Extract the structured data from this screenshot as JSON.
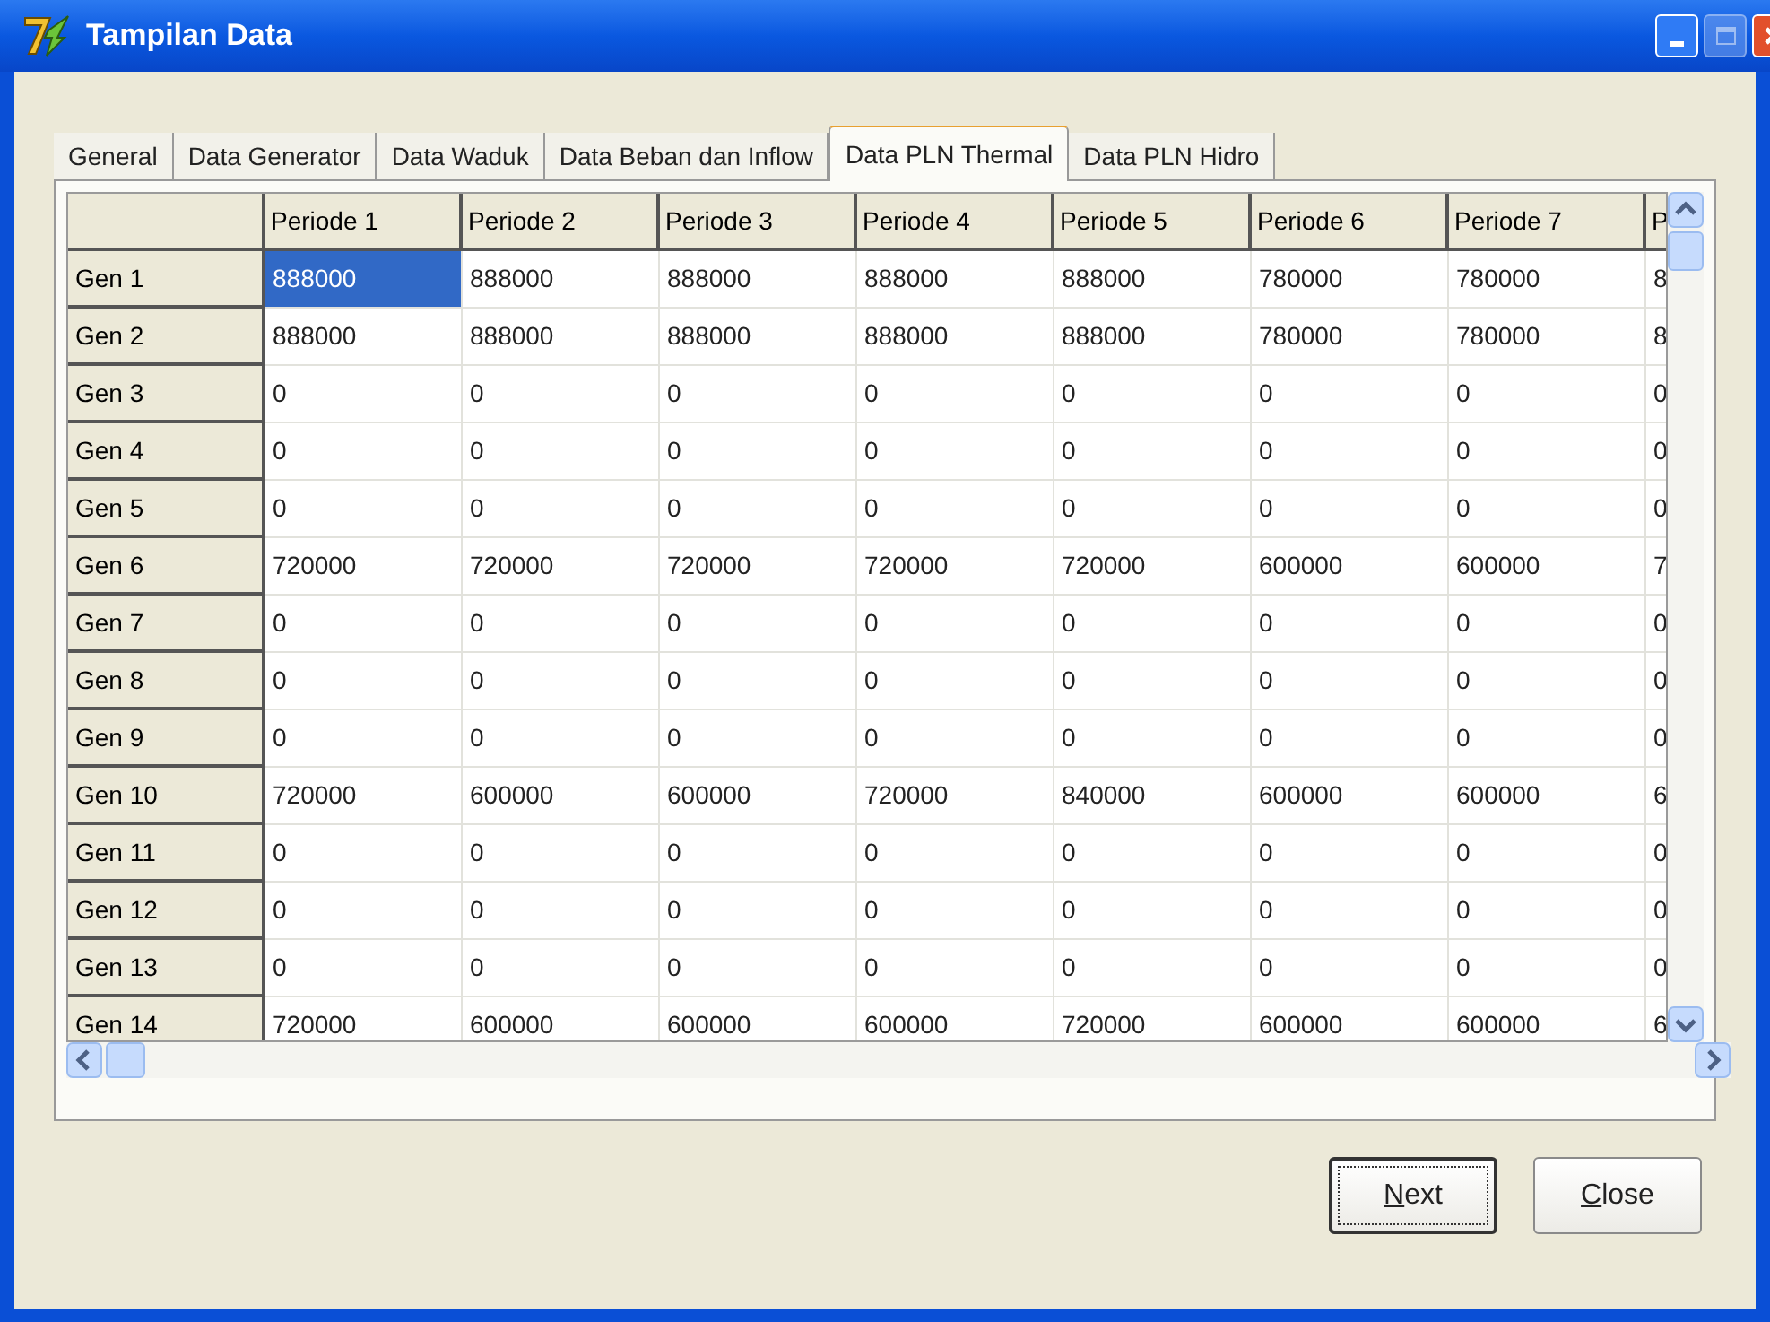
{
  "window": {
    "title": "Tampilan Data",
    "maximize_disabled": true
  },
  "tabs": [
    {
      "label": "General",
      "selected": false
    },
    {
      "label": "Data Generator",
      "selected": false
    },
    {
      "label": "Data Waduk",
      "selected": false
    },
    {
      "label": "Data Beban dan Inflow",
      "selected": false
    },
    {
      "label": "Data PLN Thermal",
      "selected": true
    },
    {
      "label": "Data PLN Hidro",
      "selected": false
    }
  ],
  "table": {
    "columns": [
      "Periode 1",
      "Periode 2",
      "Periode 3",
      "Periode 4",
      "Periode 5",
      "Periode 6",
      "Periode 7",
      "P"
    ],
    "rows": [
      {
        "header": "Gen 1",
        "cells": [
          {
            "text": "888000",
            "selected": true
          },
          {
            "text": "888000",
            "selected": false
          },
          {
            "text": "888000",
            "selected": false
          },
          {
            "text": "888000",
            "selected": false
          },
          {
            "text": "888000",
            "selected": false
          },
          {
            "text": "780000",
            "selected": false
          },
          {
            "text": "780000",
            "selected": false
          },
          {
            "text": "8",
            "selected": false
          }
        ]
      },
      {
        "header": "Gen 2",
        "cells": [
          {
            "text": "888000",
            "selected": false
          },
          {
            "text": "888000",
            "selected": false
          },
          {
            "text": "888000",
            "selected": false
          },
          {
            "text": "888000",
            "selected": false
          },
          {
            "text": "888000",
            "selected": false
          },
          {
            "text": "780000",
            "selected": false
          },
          {
            "text": "780000",
            "selected": false
          },
          {
            "text": "8",
            "selected": false
          }
        ]
      },
      {
        "header": "Gen 3",
        "cells": [
          {
            "text": "0",
            "selected": false
          },
          {
            "text": "0",
            "selected": false
          },
          {
            "text": "0",
            "selected": false
          },
          {
            "text": "0",
            "selected": false
          },
          {
            "text": "0",
            "selected": false
          },
          {
            "text": "0",
            "selected": false
          },
          {
            "text": "0",
            "selected": false
          },
          {
            "text": "0",
            "selected": false
          }
        ]
      },
      {
        "header": "Gen 4",
        "cells": [
          {
            "text": "0",
            "selected": false
          },
          {
            "text": "0",
            "selected": false
          },
          {
            "text": "0",
            "selected": false
          },
          {
            "text": "0",
            "selected": false
          },
          {
            "text": "0",
            "selected": false
          },
          {
            "text": "0",
            "selected": false
          },
          {
            "text": "0",
            "selected": false
          },
          {
            "text": "0",
            "selected": false
          }
        ]
      },
      {
        "header": "Gen 5",
        "cells": [
          {
            "text": "0",
            "selected": false
          },
          {
            "text": "0",
            "selected": false
          },
          {
            "text": "0",
            "selected": false
          },
          {
            "text": "0",
            "selected": false
          },
          {
            "text": "0",
            "selected": false
          },
          {
            "text": "0",
            "selected": false
          },
          {
            "text": "0",
            "selected": false
          },
          {
            "text": "0",
            "selected": false
          }
        ]
      },
      {
        "header": "Gen 6",
        "cells": [
          {
            "text": "720000",
            "selected": false
          },
          {
            "text": "720000",
            "selected": false
          },
          {
            "text": "720000",
            "selected": false
          },
          {
            "text": "720000",
            "selected": false
          },
          {
            "text": "720000",
            "selected": false
          },
          {
            "text": "600000",
            "selected": false
          },
          {
            "text": "600000",
            "selected": false
          },
          {
            "text": "7",
            "selected": false
          }
        ]
      },
      {
        "header": "Gen 7",
        "cells": [
          {
            "text": "0",
            "selected": false
          },
          {
            "text": "0",
            "selected": false
          },
          {
            "text": "0",
            "selected": false
          },
          {
            "text": "0",
            "selected": false
          },
          {
            "text": "0",
            "selected": false
          },
          {
            "text": "0",
            "selected": false
          },
          {
            "text": "0",
            "selected": false
          },
          {
            "text": "0",
            "selected": false
          }
        ]
      },
      {
        "header": "Gen 8",
        "cells": [
          {
            "text": "0",
            "selected": false
          },
          {
            "text": "0",
            "selected": false
          },
          {
            "text": "0",
            "selected": false
          },
          {
            "text": "0",
            "selected": false
          },
          {
            "text": "0",
            "selected": false
          },
          {
            "text": "0",
            "selected": false
          },
          {
            "text": "0",
            "selected": false
          },
          {
            "text": "0",
            "selected": false
          }
        ]
      },
      {
        "header": "Gen 9",
        "cells": [
          {
            "text": "0",
            "selected": false
          },
          {
            "text": "0",
            "selected": false
          },
          {
            "text": "0",
            "selected": false
          },
          {
            "text": "0",
            "selected": false
          },
          {
            "text": "0",
            "selected": false
          },
          {
            "text": "0",
            "selected": false
          },
          {
            "text": "0",
            "selected": false
          },
          {
            "text": "0",
            "selected": false
          }
        ]
      },
      {
        "header": "Gen 10",
        "cells": [
          {
            "text": "720000",
            "selected": false
          },
          {
            "text": "600000",
            "selected": false
          },
          {
            "text": "600000",
            "selected": false
          },
          {
            "text": "720000",
            "selected": false
          },
          {
            "text": "840000",
            "selected": false
          },
          {
            "text": "600000",
            "selected": false
          },
          {
            "text": "600000",
            "selected": false
          },
          {
            "text": "6",
            "selected": false
          }
        ]
      },
      {
        "header": "Gen 11",
        "cells": [
          {
            "text": "0",
            "selected": false
          },
          {
            "text": "0",
            "selected": false
          },
          {
            "text": "0",
            "selected": false
          },
          {
            "text": "0",
            "selected": false
          },
          {
            "text": "0",
            "selected": false
          },
          {
            "text": "0",
            "selected": false
          },
          {
            "text": "0",
            "selected": false
          },
          {
            "text": "0",
            "selected": false
          }
        ]
      },
      {
        "header": "Gen 12",
        "cells": [
          {
            "text": "0",
            "selected": false
          },
          {
            "text": "0",
            "selected": false
          },
          {
            "text": "0",
            "selected": false
          },
          {
            "text": "0",
            "selected": false
          },
          {
            "text": "0",
            "selected": false
          },
          {
            "text": "0",
            "selected": false
          },
          {
            "text": "0",
            "selected": false
          },
          {
            "text": "0",
            "selected": false
          }
        ]
      },
      {
        "header": "Gen 13",
        "cells": [
          {
            "text": "0",
            "selected": false
          },
          {
            "text": "0",
            "selected": false
          },
          {
            "text": "0",
            "selected": false
          },
          {
            "text": "0",
            "selected": false
          },
          {
            "text": "0",
            "selected": false
          },
          {
            "text": "0",
            "selected": false
          },
          {
            "text": "0",
            "selected": false
          },
          {
            "text": "0",
            "selected": false
          }
        ]
      },
      {
        "header": "Gen 14",
        "cells": [
          {
            "text": "720000",
            "selected": false
          },
          {
            "text": "600000",
            "selected": false
          },
          {
            "text": "600000",
            "selected": false
          },
          {
            "text": "600000",
            "selected": false
          },
          {
            "text": "720000",
            "selected": false
          },
          {
            "text": "600000",
            "selected": false
          },
          {
            "text": "600000",
            "selected": false
          },
          {
            "text": "6",
            "selected": false
          }
        ]
      }
    ]
  },
  "buttons": [
    {
      "label": "Next",
      "first_letter_underlined": true,
      "default": true
    },
    {
      "label": "Close",
      "first_letter_underlined": true,
      "default": false
    }
  ]
}
